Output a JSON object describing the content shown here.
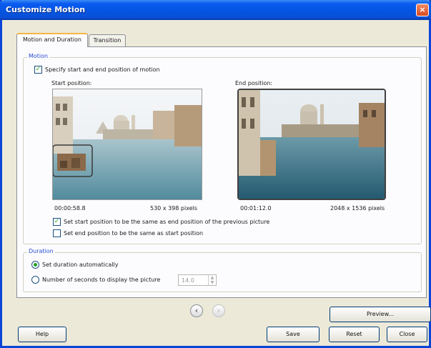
{
  "window": {
    "title": "Customize Motion",
    "close_glyph": "×"
  },
  "tabs": [
    {
      "label": "Motion and Duration",
      "active": true
    },
    {
      "label": "Transition",
      "active": false
    }
  ],
  "motion": {
    "group_label": "Motion",
    "specify_checkbox": {
      "label": "Specify start and end position of motion",
      "checked": true
    },
    "start": {
      "label": "Start position:",
      "time": "00:00:58.8",
      "size": "530 x 398 pixels"
    },
    "end": {
      "label": "End position:",
      "time": "00:01:12.0",
      "size": "2048 x 1536 pixels"
    },
    "same_as_previous": {
      "label": "Set start position to be the same as end position of the previous picture",
      "checked": true
    },
    "same_as_start": {
      "label": "Set end position to be the same as start position",
      "checked": false
    }
  },
  "duration": {
    "group_label": "Duration",
    "auto_radio": {
      "label": "Set duration automatically",
      "selected": true
    },
    "seconds_radio": {
      "label": "Number of seconds to display the picture",
      "selected": false
    },
    "seconds_value": "14.0"
  },
  "nav": {
    "prev_glyph": "‹",
    "next_glyph": "›"
  },
  "buttons": {
    "preview": "Preview...",
    "help": "Help",
    "save": "Save",
    "reset": "Reset",
    "close": "Close"
  },
  "colors": {
    "title_bar": "#0454e0",
    "accent_label": "#2a4ed0",
    "check_mark": "#21a121"
  }
}
